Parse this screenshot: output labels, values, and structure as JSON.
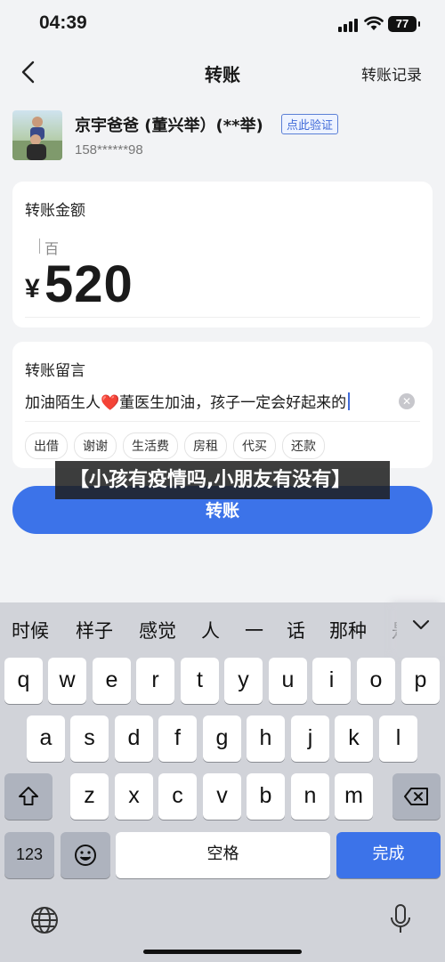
{
  "status": {
    "time": "04:39",
    "battery": "77"
  },
  "nav": {
    "title": "转账",
    "right_link": "转账记录"
  },
  "payee": {
    "name": "京宇爸爸 (董兴举）(**举)",
    "verify_label": "点此验证",
    "phone": "158******98"
  },
  "amount": {
    "label": "转账金额",
    "unit_hint": "百",
    "currency": "¥",
    "value": "520"
  },
  "message": {
    "label": "转账留言",
    "text_before": "加油陌生人",
    "emoji": "❤️",
    "text_after": "董医生加油，孩子一定会好起来的",
    "chips": [
      "出借",
      "谢谢",
      "生活费",
      "房租",
      "代买",
      "还款"
    ]
  },
  "transfer_button": "转账",
  "overlay_banner": "【小孩有疫情吗,小朋友有没有】",
  "keyboard": {
    "candidates": [
      "时候",
      "样子",
      "感觉",
      "人",
      "一",
      "话",
      "那种",
      "是"
    ],
    "row1": [
      "q",
      "w",
      "e",
      "r",
      "t",
      "y",
      "u",
      "i",
      "o",
      "p"
    ],
    "row2": [
      "a",
      "s",
      "d",
      "f",
      "g",
      "h",
      "j",
      "k",
      "l"
    ],
    "row3": [
      "z",
      "x",
      "c",
      "v",
      "b",
      "n",
      "m"
    ],
    "numbers_key": "123",
    "space_key": "空格",
    "done_key": "完成"
  },
  "icons": {
    "back": "chevron-left-icon",
    "clear": "clear-circle-icon",
    "shift": "shift-icon",
    "delete": "backspace-icon",
    "emoji": "emoji-icon",
    "globe": "globe-icon",
    "mic": "microphone-icon",
    "collapse": "chevron-down-icon"
  }
}
